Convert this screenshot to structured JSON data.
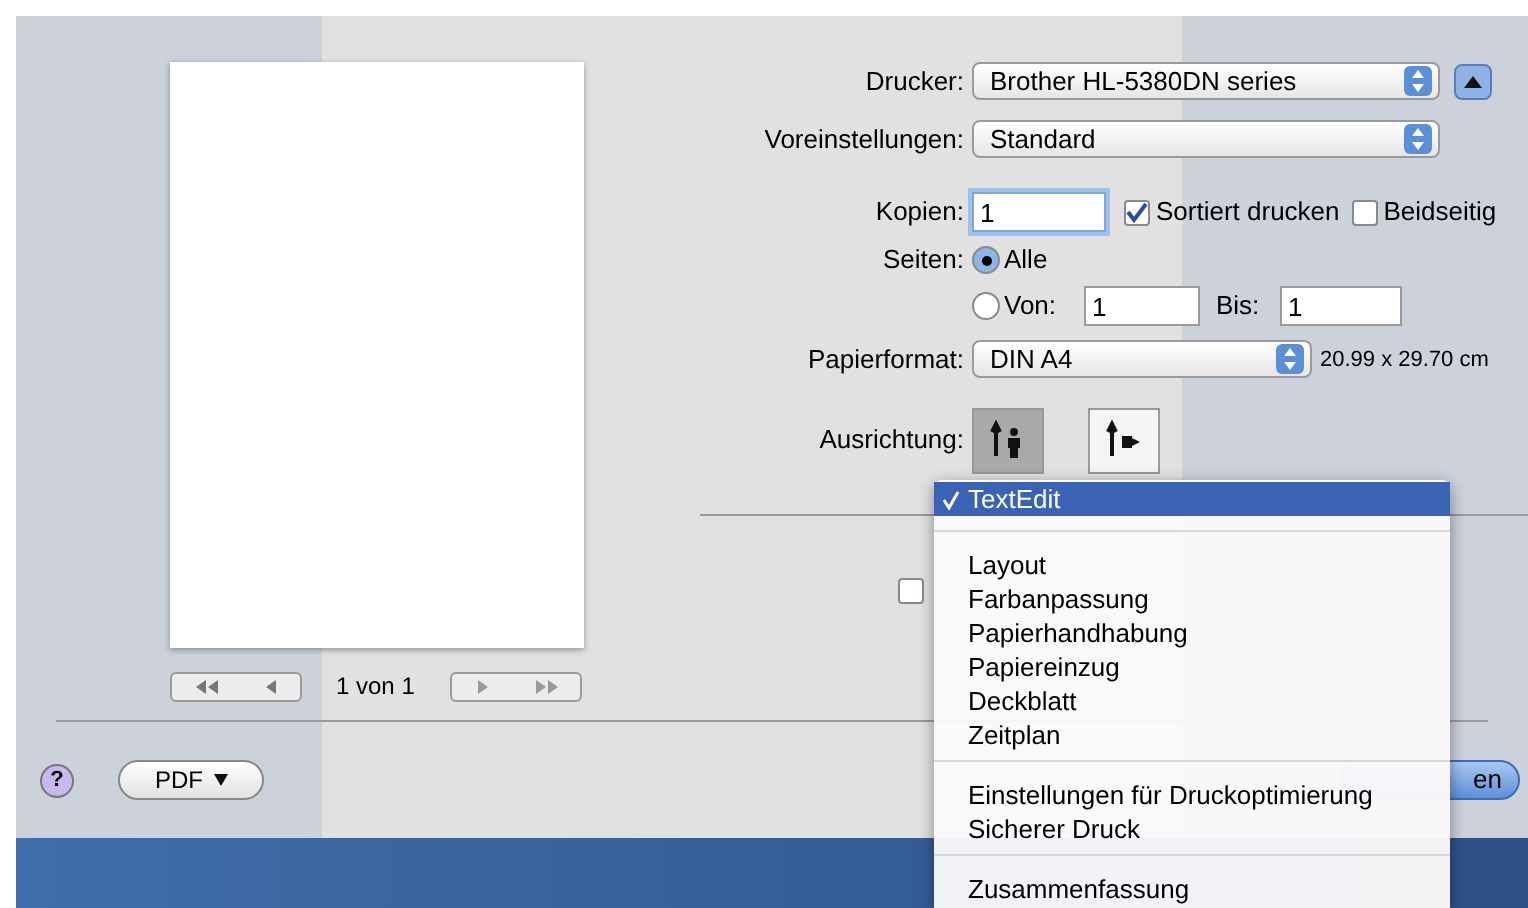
{
  "preview": {
    "page_label": "1 von 1"
  },
  "printer": {
    "label": "Drucker:",
    "value": "Brother HL-5380DN series"
  },
  "presets": {
    "label": "Voreinstellungen:",
    "value": "Standard"
  },
  "copies": {
    "label": "Kopien:",
    "value": "1",
    "collate": {
      "label": "Sortiert drucken",
      "checked": true
    },
    "two_sided": {
      "label": "Beidseitig",
      "checked": false
    }
  },
  "pages": {
    "label": "Seiten:",
    "options": [
      {
        "label": "Alle",
        "selected": true
      },
      {
        "label": "Von:",
        "selected": false
      }
    ],
    "from": "1",
    "to_label": "Bis:",
    "to": "1"
  },
  "paper_size": {
    "label": "Papierformat:",
    "value": "DIN A4",
    "dimensions": "20.99 x 29.70 cm"
  },
  "orientation": {
    "label": "Ausrichtung:",
    "options": [
      {
        "kind": "portrait",
        "selected": true
      },
      {
        "kind": "landscape",
        "selected": false
      }
    ]
  },
  "header_footer_checkbox": {
    "checked": false
  },
  "footer": {
    "help": "?",
    "pdf": "PDF",
    "print_visible": "en"
  },
  "menu": {
    "sections": [
      [
        {
          "label": "TextEdit",
          "selected": true
        }
      ],
      [
        {
          "label": "Layout",
          "selected": false
        },
        {
          "label": "Farbanpassung",
          "selected": false
        },
        {
          "label": "Papierhandhabung",
          "selected": false
        },
        {
          "label": "Papiereinzug",
          "selected": false
        },
        {
          "label": "Deckblatt",
          "selected": false
        },
        {
          "label": "Zeitplan",
          "selected": false
        }
      ],
      [
        {
          "label": "Einstellungen für Druckoptimierung",
          "selected": false
        },
        {
          "label": "Sicherer Druck",
          "selected": false
        }
      ],
      [
        {
          "label": "Zusammenfassung",
          "selected": false
        }
      ]
    ]
  }
}
